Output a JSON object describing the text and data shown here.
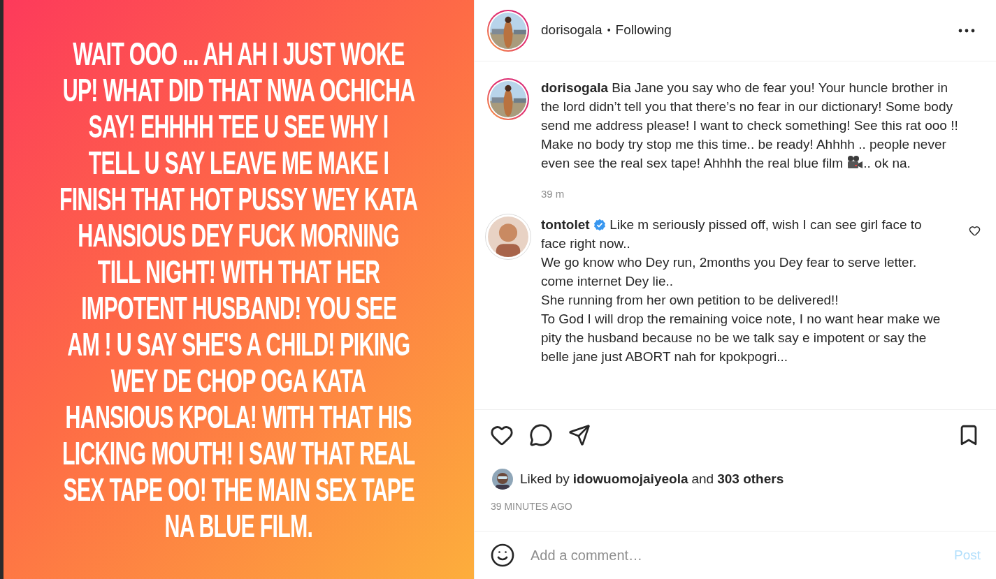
{
  "post_image": {
    "lines": [
      "WAIT OOO ... AH AH I JUST WOKE",
      "UP! WHAT DID THAT NWA OCHICHA",
      "SAY! EHHHH TEE U SEE WHY I",
      "TELL U SAY LEAVE ME MAKE I",
      "FINISH THAT HOT PUSSY WEY KATA",
      "HANSIOUS DEY FUCK MORNING",
      "TILL NIGHT! WITH THAT HER",
      "IMPOTENT HUSBAND! YOU SEE",
      "AM ! U SAY SHE'S A CHILD! PIKING",
      "WEY DE CHOP OGA KATA",
      "HANSIOUS KPOLA! WITH THAT HIS",
      "LICKING MOUTH! I SAW THAT REAL",
      "SEX TAPE OO! THE MAIN SEX TAPE",
      "NA BLUE FILM."
    ]
  },
  "header": {
    "username": "dorisogala",
    "separator": "•",
    "follow_status": "Following"
  },
  "caption": {
    "username": "dorisogala",
    "text": "Bia Jane you say who de fear you! Your huncle brother in the lord didn’t tell you that there’s no fear in our dictionary! Some body send me address please! I want to check something! See this rat ooo !! Make no body try stop me this time.. be ready! Ahhhh .. people never even see the real sex tape! Ahhhh the real blue film",
    "text_after": ".. ok na.",
    "time": "39 m"
  },
  "comments": [
    {
      "username": "tontolet",
      "verified": true,
      "liked": false,
      "paragraphs": [
        "Like m seriously pissed off, wish I can see girl face to face right now..",
        "We go know who Dey run, 2months you Dey fear to serve letter. come internet Dey lie..",
        "She running from her own petition to be delivered!!",
        "To God I will drop the remaining voice note, I no want hear make we pity the husband because no be we talk say e impotent or say the belle jane just ABORT nah for kpokpogri..."
      ]
    }
  ],
  "actions": {
    "liked": false,
    "saved": false
  },
  "likes": {
    "prefix": "Liked by",
    "user": "idowuomojaiyeola",
    "conjunction": "and",
    "count": "303 others"
  },
  "timestamp": "39 MINUTES AGO",
  "comment_box": {
    "placeholder": "Add a comment…",
    "post_button": "Post",
    "post_disabled": true
  }
}
